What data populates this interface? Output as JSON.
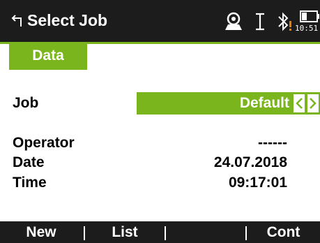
{
  "header": {
    "title": "Select Job",
    "time": "10:51",
    "icons": [
      "back-arrow-icon",
      "prism-target-icon",
      "cursor-i-beam-icon",
      "bluetooth-warning-icon",
      "battery-icon"
    ]
  },
  "tabs": [
    {
      "label": "Data"
    }
  ],
  "fields": {
    "job": {
      "label": "Job",
      "value": "Default"
    },
    "operator": {
      "label": "Operator",
      "value": "------"
    },
    "date": {
      "label": "Date",
      "value": "24.07.2018"
    },
    "time": {
      "label": "Time",
      "value": "09:17:01"
    }
  },
  "softkeys": [
    {
      "label": "New"
    },
    {
      "label": "List"
    },
    {
      "label": ""
    },
    {
      "label": "Cont"
    }
  ],
  "colors": {
    "accent": "#7ab51d",
    "bar": "#1c1c1c",
    "warning": "#e87a00"
  }
}
